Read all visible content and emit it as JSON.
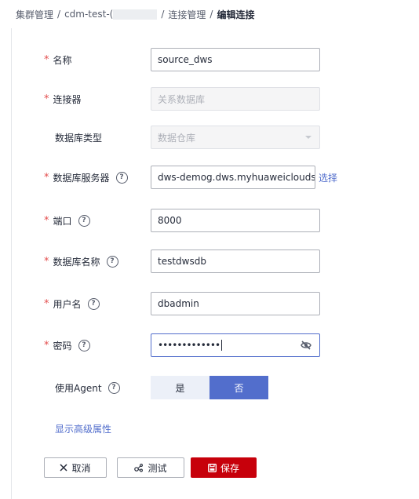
{
  "breadcrumb": {
    "item1": "集群管理",
    "item2": "cdm-test-(",
    "item3": "连接管理",
    "current": "编辑连接",
    "separator": "/"
  },
  "form": {
    "name": {
      "label": "名称",
      "value": "source_dws"
    },
    "connector": {
      "label": "连接器",
      "value": "关系数据库"
    },
    "db_type": {
      "label": "数据库类型",
      "value": "数据仓库"
    },
    "db_server": {
      "label": "数据库服务器",
      "value": "dws-demog.dws.myhuaweiclouds",
      "select_label": "选择"
    },
    "port": {
      "label": "端口",
      "value": "8000"
    },
    "db_name": {
      "label": "数据库名称",
      "value": "testdwsdb"
    },
    "username": {
      "label": "用户名",
      "value": "dbadmin"
    },
    "password": {
      "label": "密码",
      "masked": "•••••••••••••"
    },
    "use_agent": {
      "label": "使用Agent",
      "options": [
        "是",
        "否"
      ],
      "selected": "否"
    },
    "required_mark": "*",
    "help_glyph": "?"
  },
  "advanced_link": "显示高级属性",
  "buttons": {
    "cancel": "取消",
    "test": "测试",
    "save": "保存"
  },
  "colors": {
    "accent": "#526ecc",
    "danger": "#c7000b",
    "required": "#e34d4d"
  },
  "icons": [
    "close-icon",
    "test-icon",
    "save-icon",
    "eye-off-icon",
    "help-icon",
    "chevron-down-icon"
  ]
}
